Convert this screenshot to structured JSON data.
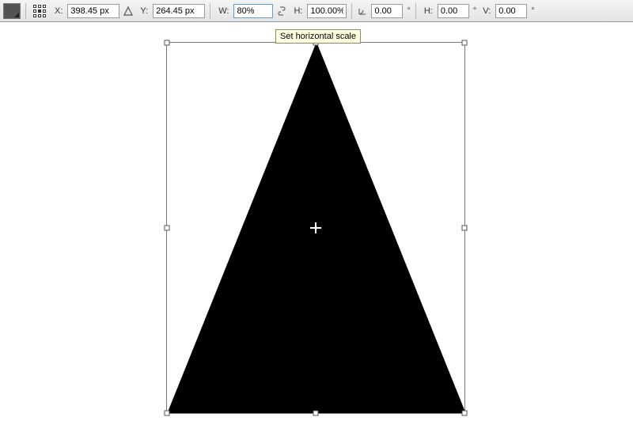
{
  "toolbar": {
    "x_label": "X:",
    "x_value": "398.45 px",
    "y_label": "Y:",
    "y_value": "264.45 px",
    "w_label": "W:",
    "w_value": "80%",
    "h_label": "H:",
    "h_value": "100.00%",
    "angle_value": "0.00",
    "shear_h_label": "H:",
    "shear_h_value": "0.00",
    "shear_v_label": "V:",
    "shear_v_value": "0.00",
    "deg": "°"
  },
  "tooltip": {
    "text": "Set horizontal scale"
  },
  "shape": {
    "fill": "#000000"
  }
}
